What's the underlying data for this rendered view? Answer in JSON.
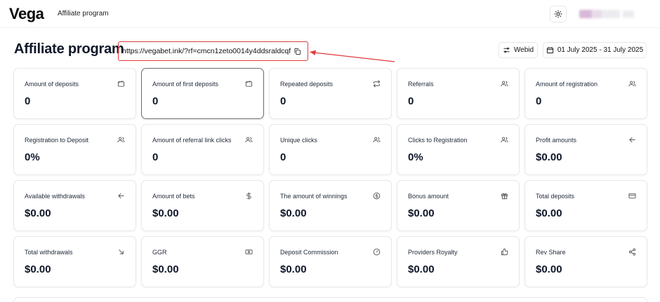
{
  "header": {
    "logo_text": "Vega",
    "nav_label": "Affiliate program",
    "theme_icon": "sun-icon"
  },
  "page": {
    "title": "Affiliate program",
    "referral_link": "https://vegabet.ink/?rf=cmcn1zeto0014y4ddsraldcqf",
    "webid_label": "Webid",
    "date_range": "01 July 2025 - 31 July 2025"
  },
  "colors": {
    "highlight": "#e03b3b",
    "text": "#0f172a",
    "border": "#e6e8ec"
  },
  "cards": [
    {
      "label": "Amount of deposits",
      "value": "0",
      "icon": "wallet-icon"
    },
    {
      "label": "Amount of first deposits",
      "value": "0",
      "icon": "wallet-icon"
    },
    {
      "label": "Repeated deposits",
      "value": "0",
      "icon": "repeat-icon"
    },
    {
      "label": "Referrals",
      "value": "0",
      "icon": "users-icon"
    },
    {
      "label": "Amount of registration",
      "value": "0",
      "icon": "users-icon"
    },
    {
      "label": "Registration to Deposit",
      "value": "0%",
      "icon": "users-icon"
    },
    {
      "label": "Amount of referral link clicks",
      "value": "0",
      "icon": "users-icon"
    },
    {
      "label": "Unique clicks",
      "value": "0",
      "icon": "users-icon"
    },
    {
      "label": "Clicks to Registration",
      "value": "0%",
      "icon": "users-icon"
    },
    {
      "label": "Profit amounts",
      "value": "$0.00",
      "icon": "arrow-left-icon"
    },
    {
      "label": "Available withdrawals",
      "value": "$0.00",
      "icon": "arrow-left-icon"
    },
    {
      "label": "Amount of bets",
      "value": "$0.00",
      "icon": "dollar-icon"
    },
    {
      "label": "The amount of winnings",
      "value": "$0.00",
      "icon": "coin-icon"
    },
    {
      "label": "Bonus amount",
      "value": "$0.00",
      "icon": "gift-icon"
    },
    {
      "label": "Total deposits",
      "value": "$0.00",
      "icon": "card-icon"
    },
    {
      "label": "Total withdrawals",
      "value": "$0.00",
      "icon": "arrow-down-right-icon"
    },
    {
      "label": "GGR",
      "value": "$0.00",
      "icon": "banknote-icon"
    },
    {
      "label": "Deposit Commission",
      "value": "$0.00",
      "icon": "gauge-icon"
    },
    {
      "label": "Providers Royalty",
      "value": "$0.00",
      "icon": "thumbs-up-icon"
    },
    {
      "label": "Rev Share",
      "value": "$0.00",
      "icon": "share-icon"
    }
  ]
}
